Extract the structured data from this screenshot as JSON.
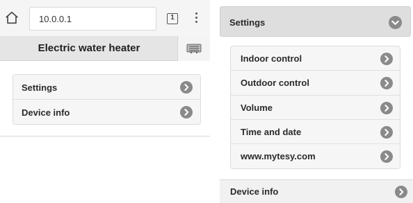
{
  "browser": {
    "url": "10.0.0.1",
    "tab_count": "1",
    "icons": {
      "home": "home-icon",
      "tabs": "tabs-icon",
      "menu": "more-vert-icon"
    }
  },
  "app": {
    "title": "Electric water heater",
    "header_icon": "water-heater-icon"
  },
  "main_menu": {
    "items": [
      {
        "label": "Settings"
      },
      {
        "label": "Device info"
      }
    ]
  },
  "settings_panel": {
    "header_label": "Settings",
    "header_icon": "chevron-down-icon",
    "items": [
      {
        "label": "Indoor control"
      },
      {
        "label": "Outdoor control"
      },
      {
        "label": "Volume"
      },
      {
        "label": "Time and date"
      },
      {
        "label": "www.mytesy.com"
      }
    ],
    "device_info_label": "Device info"
  },
  "colors": {
    "chevron_circle": "#8a8a8a",
    "header_bg": "#e5e5e5",
    "list_bg": "#f6f6f6"
  }
}
